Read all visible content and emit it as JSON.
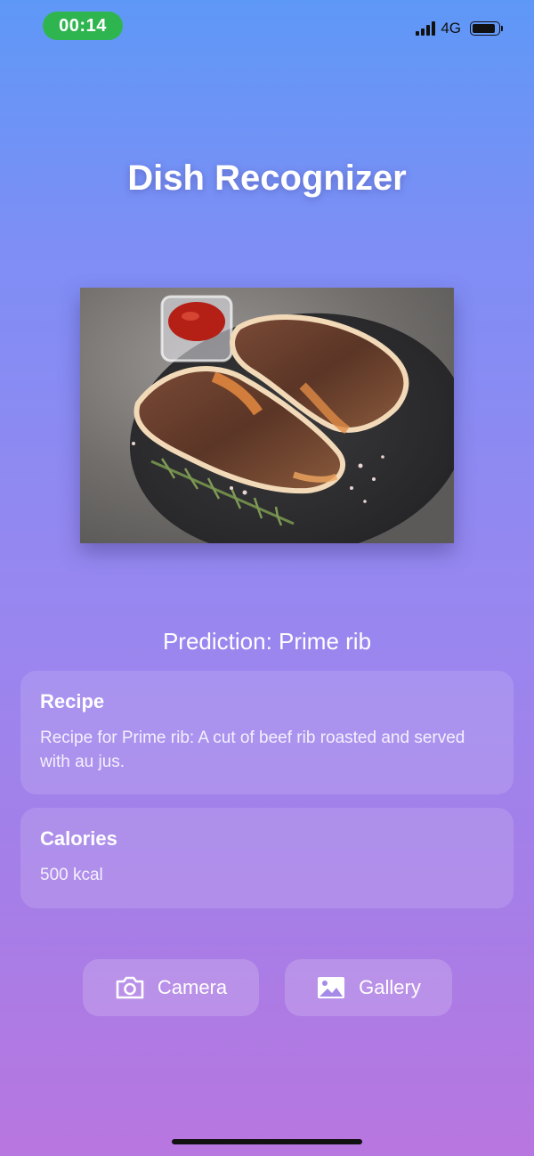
{
  "status_bar": {
    "time": "00:14",
    "network": "4G",
    "icons": [
      "signal-icon",
      "battery-icon"
    ],
    "time_pill_color": "#2fb550"
  },
  "app": {
    "title": "Dish Recognizer"
  },
  "image": {
    "description_icon": "dish-photo"
  },
  "prediction": {
    "text": "Prediction: Prime rib"
  },
  "recipe_card": {
    "title": "Recipe",
    "text": "Recipe for Prime rib: A cut of beef rib roasted and served with au jus."
  },
  "calories_card": {
    "title": "Calories",
    "text": "500 kcal"
  },
  "actions": {
    "camera_label": "Camera",
    "camera_icon": "camera-icon",
    "gallery_label": "Gallery",
    "gallery_icon": "image-icon"
  },
  "colors": {
    "gradient_top": "#5e98f7",
    "gradient_bottom": "#b876e0",
    "text": "#ffffff"
  }
}
